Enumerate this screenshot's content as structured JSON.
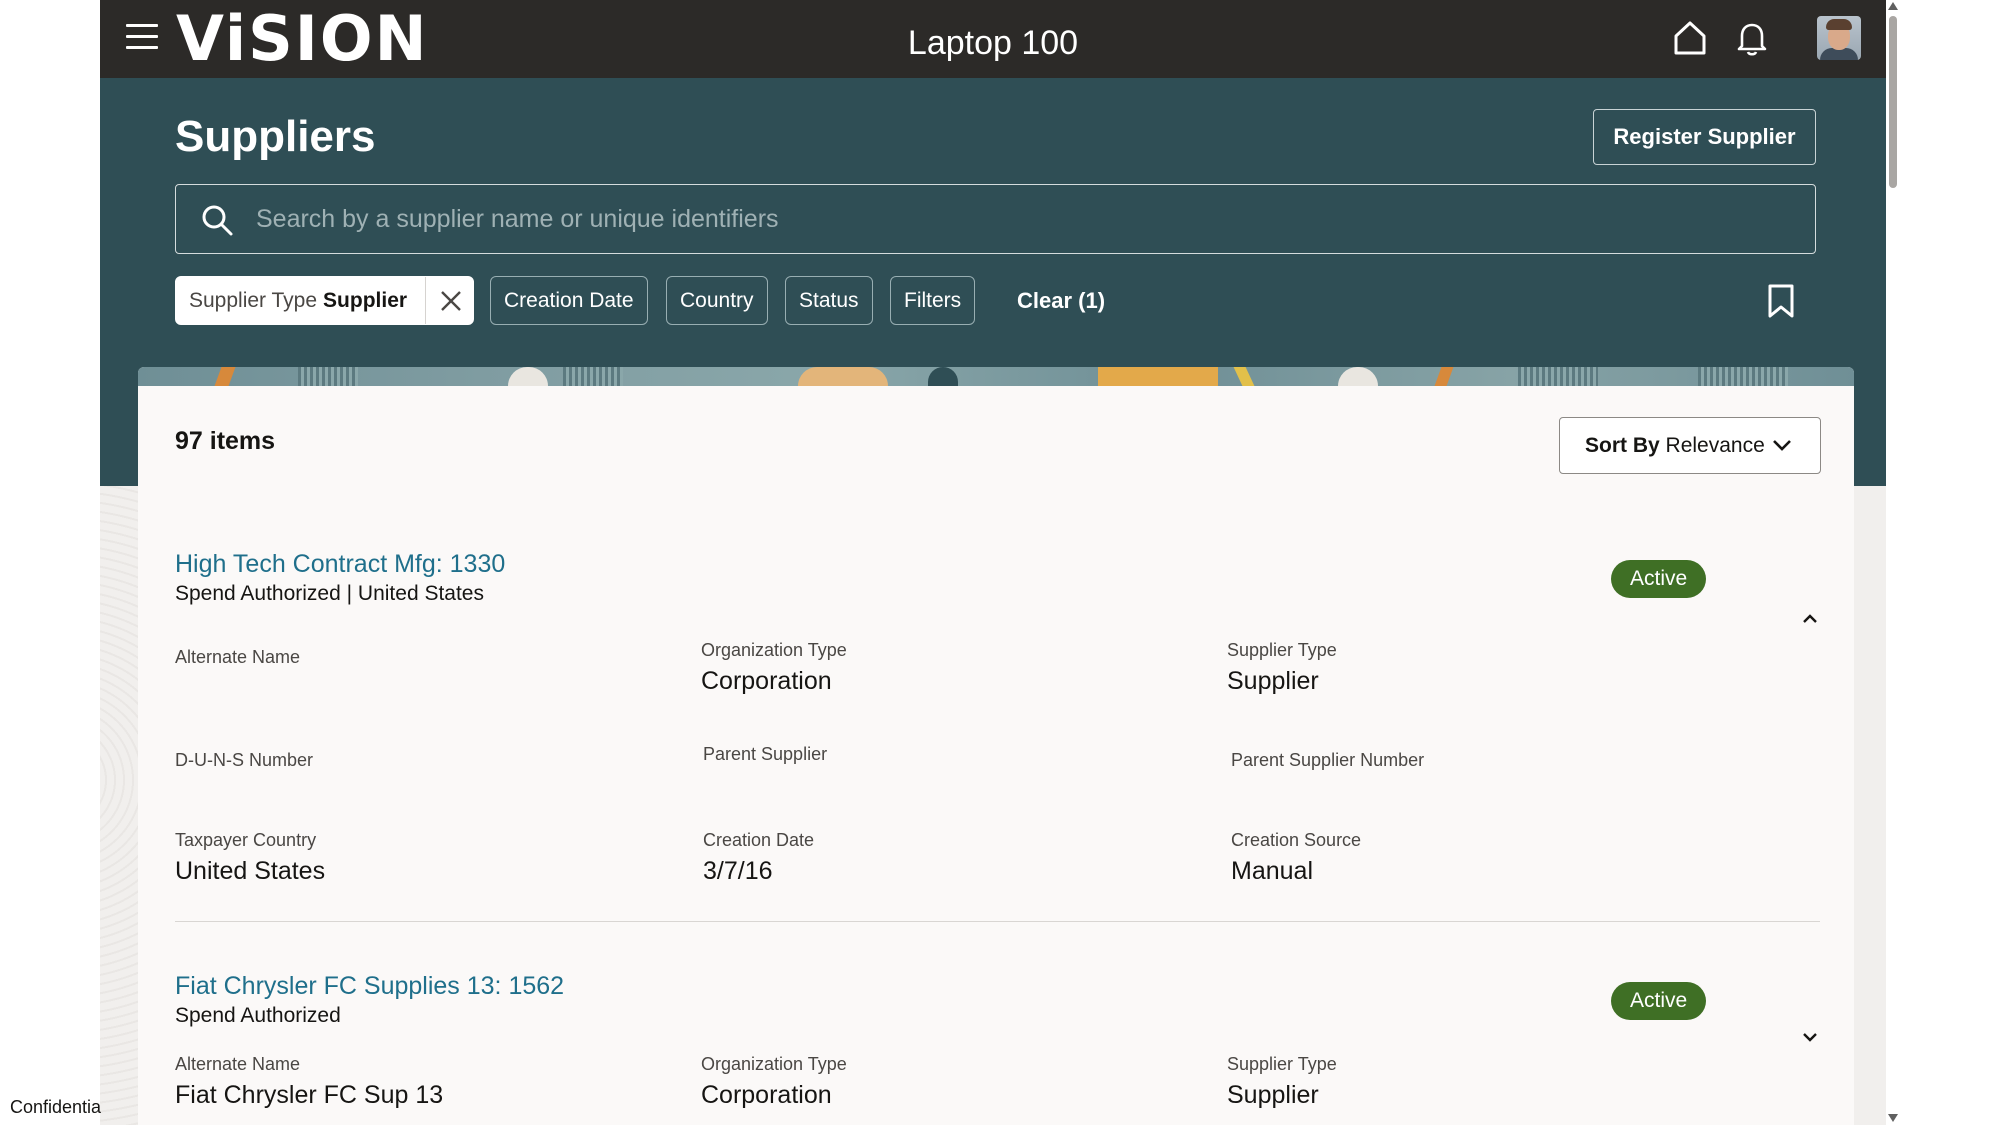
{
  "topbar": {
    "brand": "ViSION",
    "title": "Laptop 100",
    "icons": [
      "hamburger-menu-icon",
      "home-icon",
      "bell-icon",
      "avatar"
    ]
  },
  "header": {
    "page_title": "Suppliers",
    "register_label": "Register Supplier",
    "search_placeholder": "Search by a supplier name or unique identifiers",
    "search_value": "",
    "filters": {
      "active_chip": {
        "label": "Supplier Type",
        "value": "Supplier"
      },
      "chips": [
        "Creation Date",
        "Country",
        "Status",
        "Filters"
      ],
      "clear_label": "Clear (1)"
    }
  },
  "results": {
    "count_label": "97 items",
    "sort": {
      "label": "Sort By",
      "value": "Relevance"
    }
  },
  "suppliers": [
    {
      "name": "High Tech Contract Mfg: 1330",
      "subtitle": "Spend Authorized | United States",
      "status": "Active",
      "expanded": true,
      "fields": {
        "alternate_name": {
          "label": "Alternate Name",
          "value": ""
        },
        "organization_type": {
          "label": "Organization Type",
          "value": "Corporation"
        },
        "supplier_type": {
          "label": "Supplier Type",
          "value": "Supplier"
        },
        "duns_number": {
          "label": "D-U-N-S Number",
          "value": ""
        },
        "parent_supplier": {
          "label": "Parent Supplier",
          "value": ""
        },
        "parent_supplier_number": {
          "label": "Parent Supplier Number",
          "value": ""
        },
        "taxpayer_country": {
          "label": "Taxpayer Country",
          "value": "United States"
        },
        "creation_date": {
          "label": "Creation Date",
          "value": "3/7/16"
        },
        "creation_source": {
          "label": "Creation Source",
          "value": "Manual"
        }
      }
    },
    {
      "name": "Fiat Chrysler FC Supplies 13: 1562",
      "subtitle": "Spend Authorized",
      "status": "Active",
      "expanded": false,
      "fields": {
        "alternate_name": {
          "label": "Alternate Name",
          "value": "Fiat Chrysler FC Sup 13"
        },
        "organization_type": {
          "label": "Organization Type",
          "value": "Corporation"
        },
        "supplier_type": {
          "label": "Supplier Type",
          "value": "Supplier"
        }
      }
    }
  ],
  "footer": {
    "confidential": "Confidential"
  },
  "colors": {
    "topbar": "#2c2a28",
    "header_band": "#2f4e55",
    "link": "#1f6f8b",
    "status_active": "#3f6f25",
    "card": "#fbf9f8"
  }
}
